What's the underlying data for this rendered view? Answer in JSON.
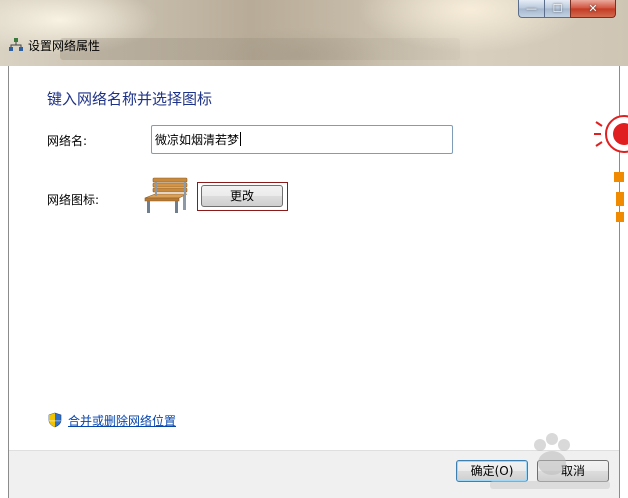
{
  "window": {
    "title": "设置网络属性",
    "caption": {
      "minimize_glyph": "—",
      "maximize_glyph": "☐",
      "close_glyph": "✕"
    }
  },
  "main": {
    "heading": "键入网络名称并选择图标",
    "name_label": "网络名:",
    "name_value": "微凉如烟清若梦",
    "icon_label": "网络图标:",
    "change_button": "更改",
    "merge_link": "合并或删除网络位置"
  },
  "footer": {
    "ok_button": "确定(O)",
    "cancel_button": "取消"
  },
  "colors": {
    "heading": "#1e3287",
    "link": "#0645ad",
    "focus_border": "#8b1a1a"
  }
}
